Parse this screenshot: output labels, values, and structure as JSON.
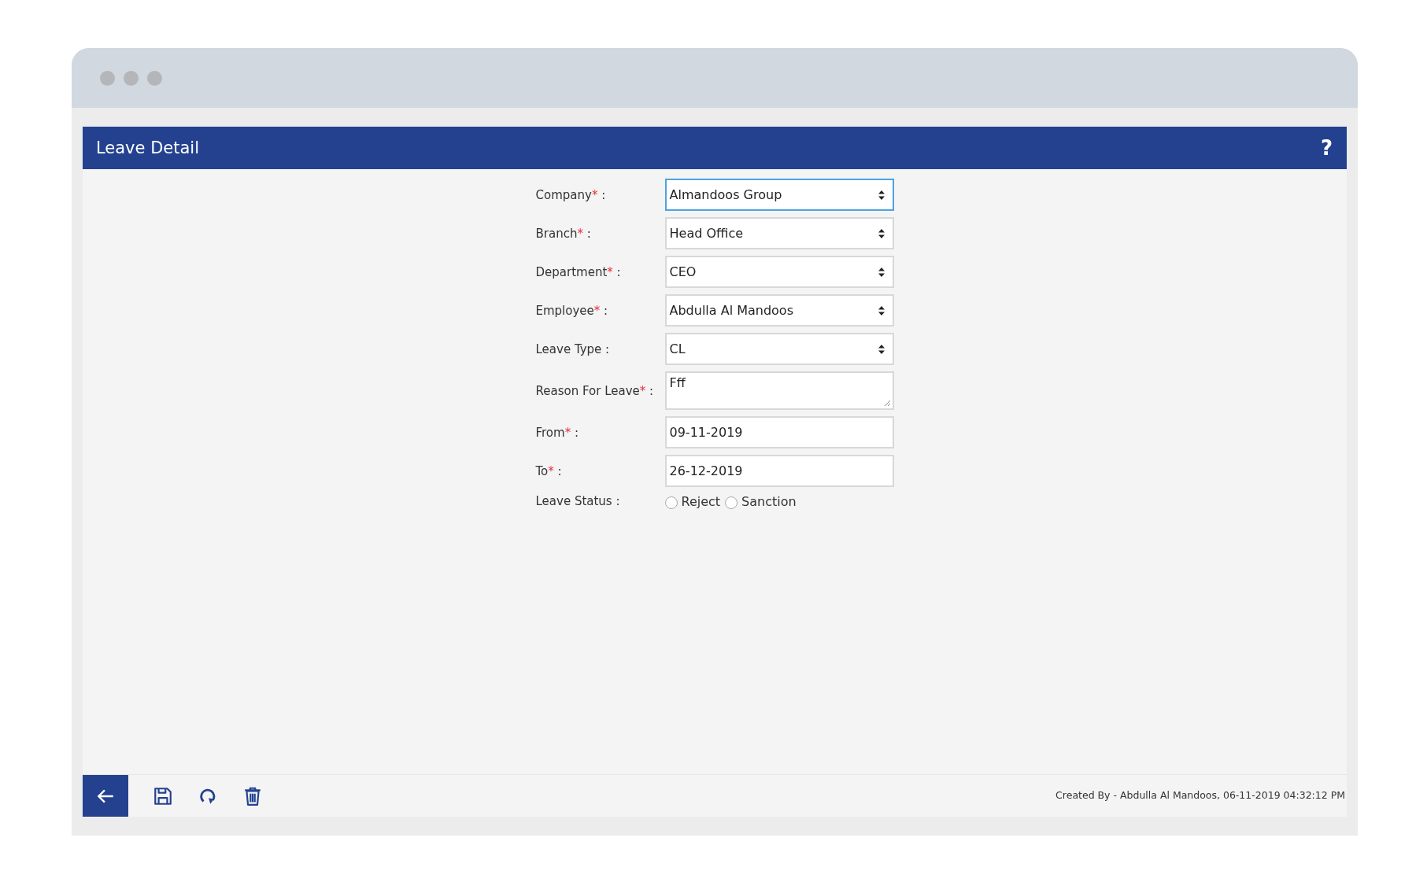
{
  "panel": {
    "title": "Leave Detail",
    "help": "?"
  },
  "fields": [
    {
      "label": "Company",
      "required_mark": "*",
      "separator": ":",
      "kind": "select",
      "value": "Almandoos Group",
      "focused": true
    },
    {
      "label": "Branch",
      "required_mark": "*",
      "separator": ":",
      "kind": "select",
      "value": "Head Office",
      "focused": false
    },
    {
      "label": "Department",
      "required_mark": "*",
      "separator": ":",
      "kind": "select",
      "value": "CEO",
      "focused": false
    },
    {
      "label": "Employee",
      "required_mark": "*",
      "separator": ":",
      "kind": "select",
      "value": "Abdulla Al Mandoos",
      "focused": false
    },
    {
      "label": "Leave Type",
      "separator": ":",
      "kind": "select",
      "value": "CL",
      "focused": false
    },
    {
      "label": "Reason For Leave",
      "required_mark": "*",
      "separator": ":",
      "kind": "textarea",
      "value": "Fff",
      "focused": false
    },
    {
      "label": "From",
      "required_mark": "*",
      "separator": ":",
      "kind": "date",
      "value": "09-11-2019",
      "focused": false
    },
    {
      "label": "To",
      "required_mark": "*",
      "separator": ":",
      "kind": "date",
      "value": "26-12-2019",
      "focused": false
    }
  ],
  "leave_status": {
    "label": "Leave Status",
    "separator": ":",
    "options": [
      {
        "label": "Reject",
        "selected": false
      },
      {
        "label": "Sanction",
        "selected": false
      }
    ]
  },
  "footer": {
    "created_by": "Created By - Abdulla Al Mandoos, 06-11-2019 04:32:12 PM"
  }
}
